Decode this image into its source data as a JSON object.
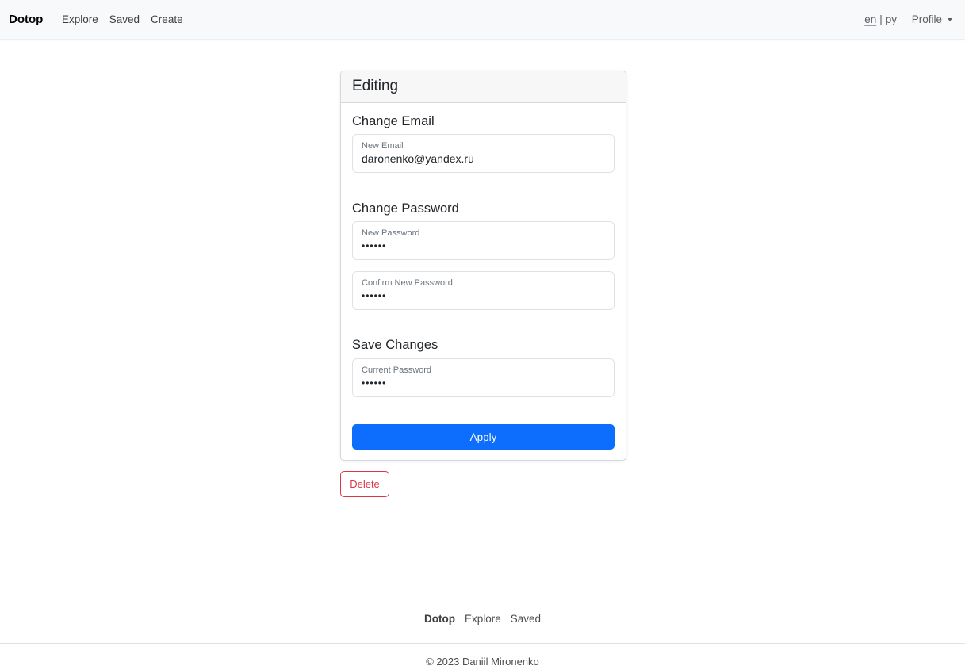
{
  "nav": {
    "brand": "Dotop",
    "links": [
      "Explore",
      "Saved",
      "Create"
    ],
    "lang_en": "en",
    "lang_sep": "|",
    "lang_ru": "py",
    "profile": "Profile"
  },
  "card": {
    "title": "Editing",
    "email_section": "Change Email",
    "email_label": "New Email",
    "email_value": "daronenko@yandex.ru",
    "password_section": "Change Password",
    "new_password_label": "New Password",
    "new_password_value": "••••••",
    "confirm_password_label": "Confirm New Password",
    "confirm_password_value": "••••••",
    "save_section": "Save Changes",
    "current_password_label": "Current Password",
    "current_password_value": "••••••",
    "apply_label": "Apply"
  },
  "delete_label": "Delete",
  "footer": {
    "brand": "Dotop",
    "links": [
      "Explore",
      "Saved"
    ],
    "copyright": "© 2023 Daniil Mironenko"
  },
  "colors": {
    "primary": "#0d6efd",
    "danger": "#dc3545",
    "navbar_bg": "#f8f9fa"
  }
}
